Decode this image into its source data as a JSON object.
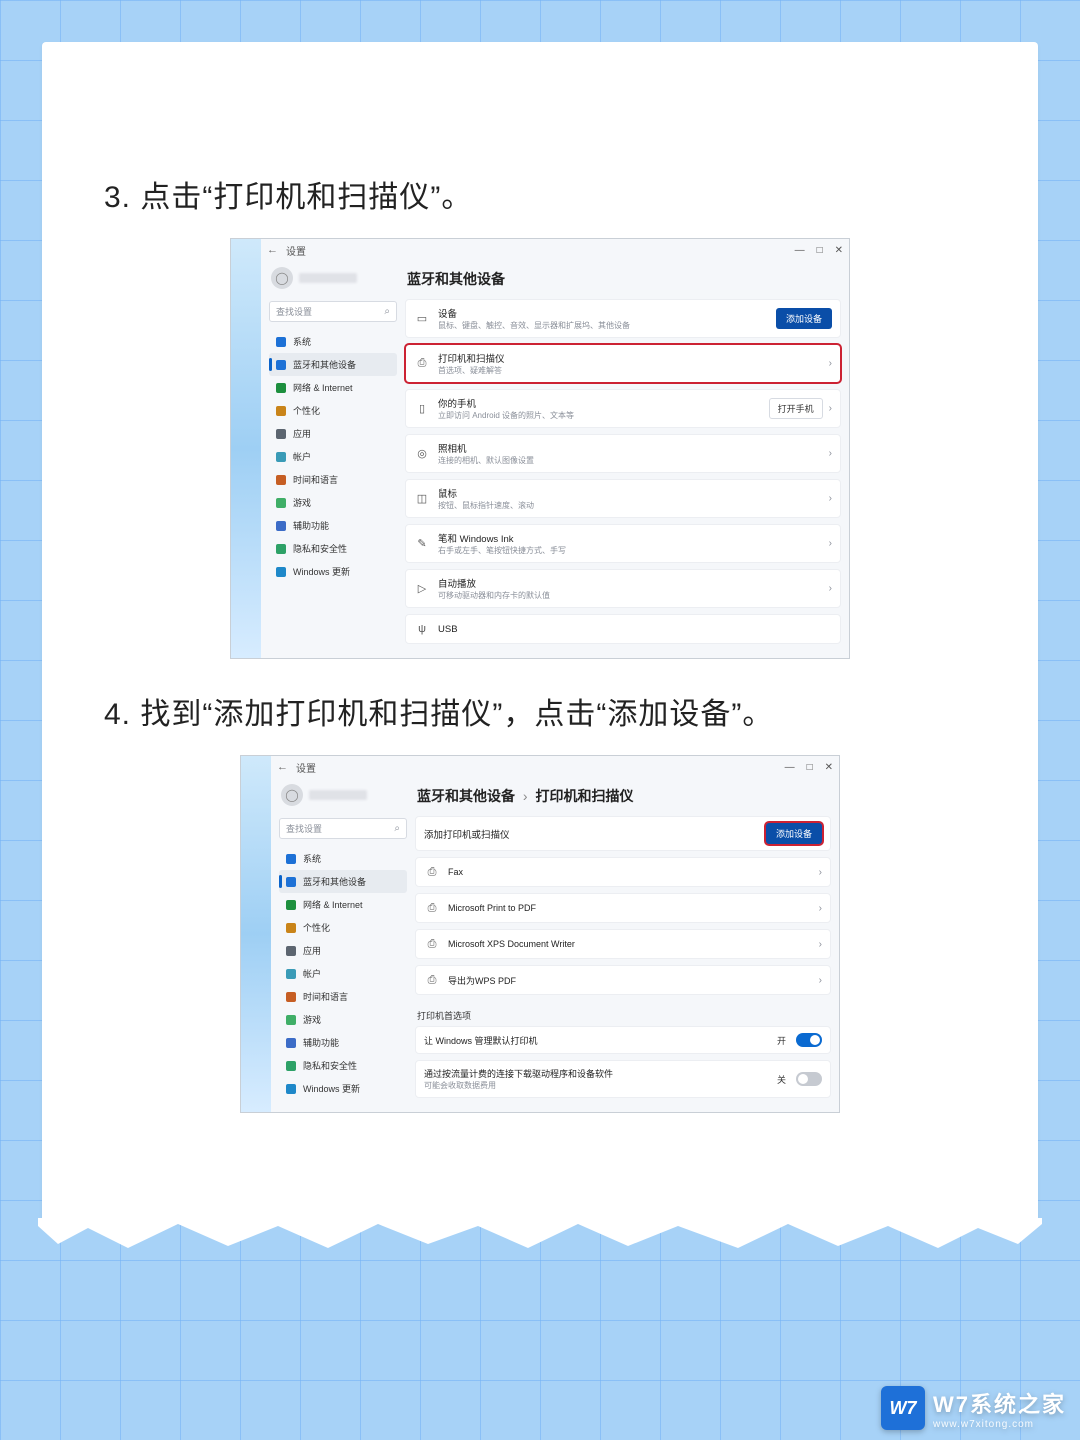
{
  "steps": {
    "s3": "3. 点击“打印机和扫描仪”。",
    "s4": "4. 找到“添加打印机和扫描仪”，点击“添加设备”。"
  },
  "window": {
    "back": "←",
    "title": "设置",
    "btn_min": "—",
    "btn_max": "□",
    "btn_close": "✕"
  },
  "sidebar": {
    "search_placeholder": "查找设置",
    "items": [
      {
        "label": "系统"
      },
      {
        "label": "蓝牙和其他设备"
      },
      {
        "label": "网络 & Internet"
      },
      {
        "label": "个性化"
      },
      {
        "label": "应用"
      },
      {
        "label": "帐户"
      },
      {
        "label": "时间和语言"
      },
      {
        "label": "游戏"
      },
      {
        "label": "辅助功能"
      },
      {
        "label": "隐私和安全性"
      },
      {
        "label": "Windows 更新"
      }
    ]
  },
  "shot1": {
    "title": "蓝牙和其他设备",
    "add_device": "添加设备",
    "rows": [
      {
        "title": "设备",
        "sub": "鼠标、键盘、触控、音效、显示器和扩展坞、其他设备"
      },
      {
        "title": "打印机和扫描仪",
        "sub": "首选项、疑难解答"
      },
      {
        "title": "你的手机",
        "sub": "立即访问 Android 设备的照片、文本等",
        "btn": "打开手机"
      },
      {
        "title": "照相机",
        "sub": "连接的相机、默认图像设置"
      },
      {
        "title": "鼠标",
        "sub": "按钮、鼠标指针速度、滚动"
      },
      {
        "title": "笔和 Windows Ink",
        "sub": "右手或左手、笔按钮快捷方式、手写"
      },
      {
        "title": "自动播放",
        "sub": "可移动驱动器和内存卡的默认值"
      },
      {
        "title": "USB",
        "sub": ""
      }
    ]
  },
  "shot2": {
    "title_a": "蓝牙和其他设备",
    "title_b": "打印机和扫描仪",
    "add_row": "添加打印机或扫描仪",
    "add_btn": "添加设备",
    "printers": [
      {
        "label": "Fax"
      },
      {
        "label": "Microsoft Print to PDF"
      },
      {
        "label": "Microsoft XPS Document Writer"
      },
      {
        "label": "导出为WPS PDF"
      }
    ],
    "prefs_label": "打印机首选项",
    "pref_rows": [
      {
        "label": "让 Windows 管理默认打印机",
        "state": "开",
        "on": true
      },
      {
        "label": "通过按流量计费的连接下载驱动程序和设备软件",
        "sub": "可能会收取数据费用",
        "state": "关",
        "on": false
      }
    ]
  },
  "watermark": {
    "badge": "W7",
    "title": "W7系统之家",
    "url": "www.w7xitong.com"
  }
}
